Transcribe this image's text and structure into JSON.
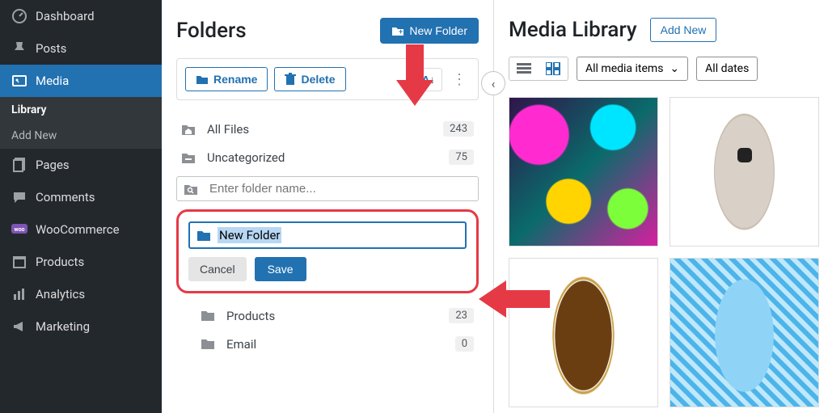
{
  "sidebar": {
    "items": [
      {
        "label": "Dashboard",
        "icon": "gauge"
      },
      {
        "label": "Posts",
        "icon": "pin"
      },
      {
        "label": "Media",
        "icon": "media"
      },
      {
        "label": "Pages",
        "icon": "pages"
      },
      {
        "label": "Comments",
        "icon": "comment"
      },
      {
        "label": "WooCommerce",
        "icon": "woo"
      },
      {
        "label": "Products",
        "icon": "archive"
      },
      {
        "label": "Analytics",
        "icon": "bars"
      },
      {
        "label": "Marketing",
        "icon": "megaphone"
      }
    ],
    "media_sub": [
      {
        "label": "Library"
      },
      {
        "label": "Add New"
      }
    ]
  },
  "folders": {
    "title": "Folders",
    "new_btn": "New Folder",
    "rename": "Rename",
    "delete": "Delete",
    "sort": "A↕",
    "search_placeholder": "Enter folder name...",
    "rows": [
      {
        "label": "All Files",
        "count": "243",
        "icon": "home"
      },
      {
        "label": "Uncategorized",
        "count": "75",
        "icon": "folder-dash"
      }
    ],
    "new_folder_value": "New Folder",
    "cancel": "Cancel",
    "save": "Save",
    "nested": [
      {
        "label": "Products",
        "count": "23"
      },
      {
        "label": "Email",
        "count": "0"
      }
    ]
  },
  "media": {
    "title": "Media Library",
    "add_new": "Add New",
    "filter_items": "All media items",
    "filter_dates": "All dates"
  }
}
